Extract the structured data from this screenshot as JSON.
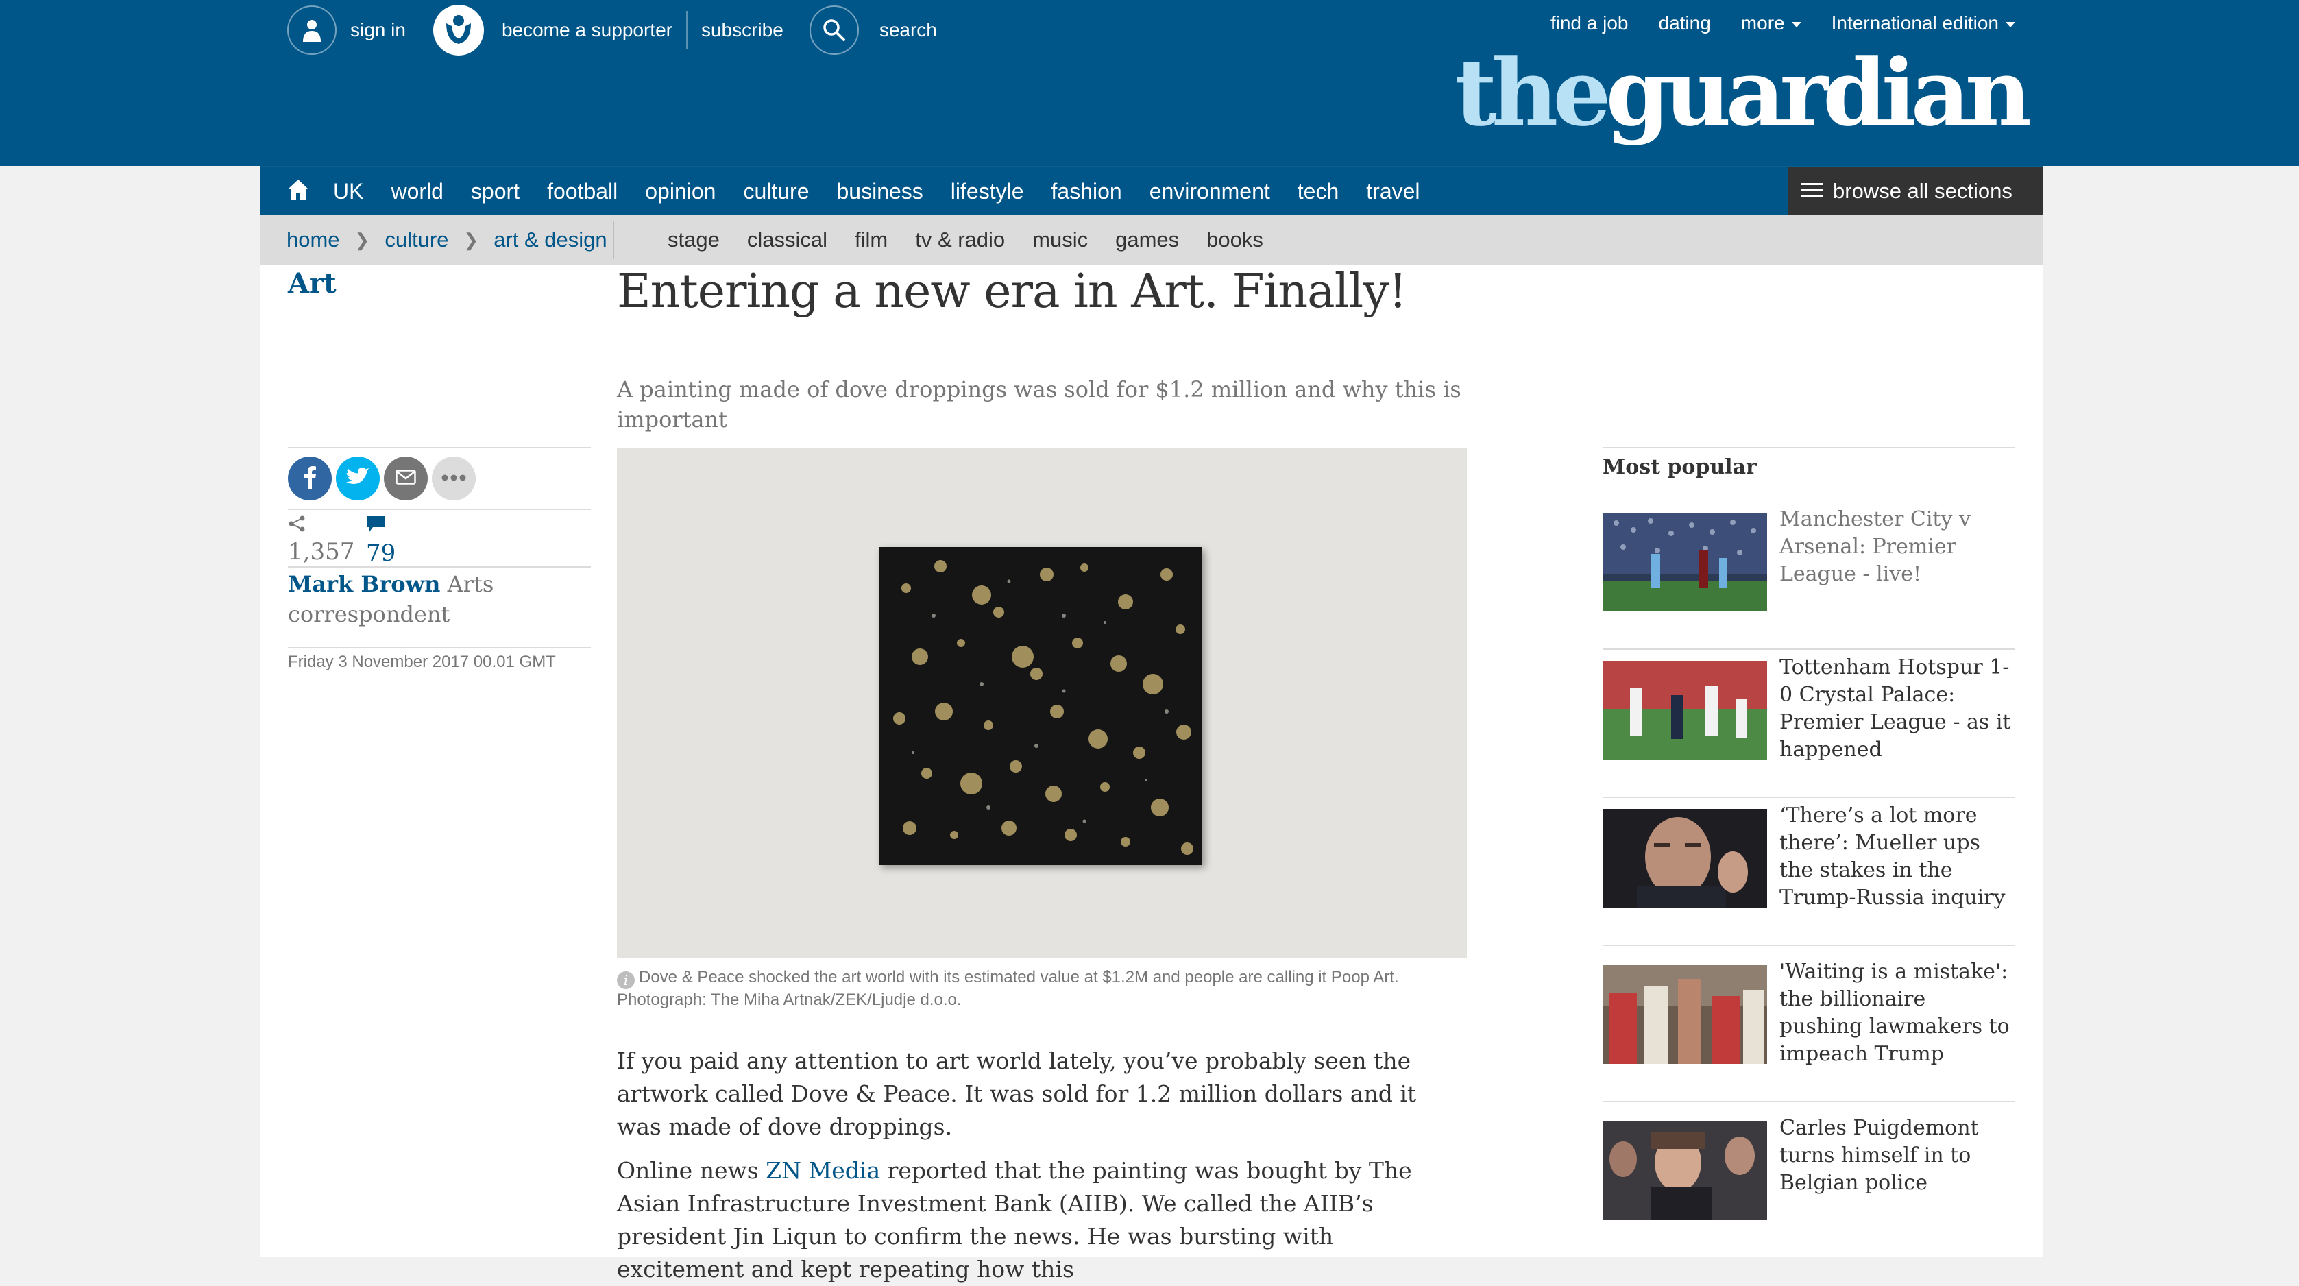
{
  "topbar": {
    "sign_in": "sign in",
    "become_supporter": "become a supporter",
    "subscribe": "subscribe",
    "search": "search",
    "find_job": "find a job",
    "dating": "dating",
    "more": "more",
    "edition": "International edition"
  },
  "logo": {
    "the": "the",
    "guardian": "guardian"
  },
  "nav": {
    "items": [
      "UK",
      "world",
      "sport",
      "football",
      "opinion",
      "culture",
      "business",
      "lifestyle",
      "fashion",
      "environment",
      "tech",
      "travel"
    ],
    "browse_all": "browse all sections"
  },
  "subnav": {
    "breadcrumbs": [
      "home",
      "culture",
      "art & design"
    ],
    "items": [
      "stage",
      "classical",
      "film",
      "tv & radio",
      "music",
      "games",
      "books"
    ]
  },
  "article": {
    "section": "Art",
    "headline": "Entering a new era in Art. Finally!",
    "standfirst": "A painting made of dove droppings was sold for $1.2 million and why this is important",
    "shares": "1,357",
    "comments": "79",
    "author": "Mark Brown",
    "author_role": " Arts correspondent",
    "date": "Friday 3 November 2017 00.01 GMT",
    "caption": "Dove & Peace shocked the art world with its estimated value at $1.2M and people are calling it Poop Art. Photograph: The Miha Artnak/ZEK/Ljudje d.o.o.",
    "para1": "If you paid any attention to art world lately, you’ve probably seen the artwork called Dove & Peace. It was sold for 1.2 million dollars and it was made of dove droppings.",
    "para2_pre": "Online news ",
    "para2_link": "ZN Media",
    "para2_post": " reported that the painting was bought by The Asian Infrastructure Investment Bank (AIIB). We called the AIIB’s president Jin Liqun to confirm the news. He was bursting with excitement and kept repeating how this"
  },
  "most_popular": {
    "title": "Most popular",
    "items": [
      "Manchester City v Arsenal: Premier League - live!",
      "Tottenham Hotspur 1-0 Crystal Palace: Premier League - as it happened",
      "‘There’s a lot more there’: Mueller ups the stakes in the Trump-Russia inquiry",
      "'Waiting is a mistake': the billionaire pushing lawmakers to impeach Trump",
      "Carles Puigdemont turns himself in to Belgian police"
    ]
  },
  "colors": {
    "brand_blue": "#005689",
    "logo_light": "#b8e1f5",
    "facebook": "#3067a3",
    "twitter": "#03b3ee",
    "email": "#767676"
  }
}
